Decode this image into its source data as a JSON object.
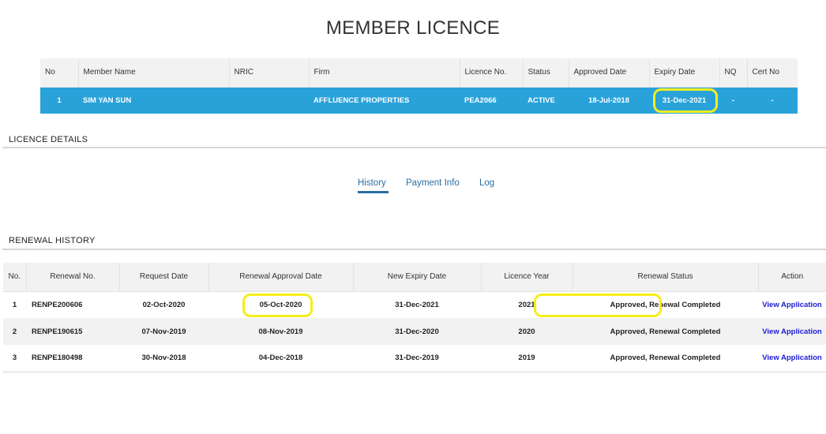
{
  "page": {
    "title": "MEMBER LICENCE"
  },
  "member_table": {
    "headers": [
      "No",
      "Member Name",
      "NRIC",
      "Firm",
      "Licence No.",
      "Status",
      "Approved Date",
      "Expiry Date",
      "NQ",
      "Cert No"
    ],
    "row": {
      "no": "1",
      "member_name": "SIM YAN SUN",
      "nric": "",
      "firm": "AFFLUENCE PROPERTIES",
      "licence_no": "PEA2066",
      "status": "ACTIVE",
      "approved_date": "18-Jul-2018",
      "expiry_date": "31-Dec-2021",
      "nq": "-",
      "cert_no": "-"
    }
  },
  "licence_details": {
    "title": "LICENCE DETAILS",
    "tabs": [
      "History",
      "Payment Info",
      "Log"
    ],
    "active_tab": "History"
  },
  "renewal_history": {
    "title": "RENEWAL HISTORY",
    "headers": [
      "No.",
      "Renewal No.",
      "Request Date",
      "Renewal Approval Date",
      "New Expiry Date",
      "Licence Year",
      "Renewal Status",
      "Action"
    ],
    "rows": [
      {
        "no": "1",
        "renewal_no": "RENPE200606",
        "request_date": "02-Oct-2020",
        "approval_date": "05-Oct-2020",
        "new_expiry": "31-Dec-2021",
        "year": "2021",
        "status": "Approved, Renewal Completed",
        "action": "View Application"
      },
      {
        "no": "2",
        "renewal_no": "RENPE190615",
        "request_date": "07-Nov-2019",
        "approval_date": "08-Nov-2019",
        "new_expiry": "31-Dec-2020",
        "year": "2020",
        "status": "Approved, Renewal Completed",
        "action": "View Application"
      },
      {
        "no": "3",
        "renewal_no": "RENPE180498",
        "request_date": "30-Nov-2018",
        "approval_date": "04-Dec-2018",
        "new_expiry": "31-Dec-2019",
        "year": "2019",
        "status": "Approved, Renewal Completed",
        "action": "View Application"
      }
    ]
  },
  "colors": {
    "selected_row": "#29a2d9",
    "highlight": "#f5ee1a",
    "tab_active": "#2a6ea3",
    "link": "#1a1ad6"
  }
}
